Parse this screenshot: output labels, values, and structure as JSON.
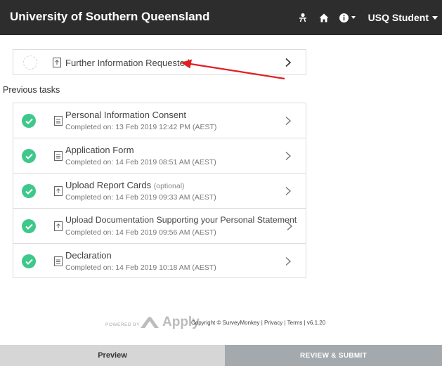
{
  "header": {
    "title": "University of Southern Queensland",
    "user_label": "USQ Student"
  },
  "current_task": {
    "title": "Further Information Requested"
  },
  "previous_label": "Previous tasks",
  "previous_tasks": [
    {
      "title": "Personal Information Consent",
      "optional": "",
      "completed": "Completed on: 13 Feb 2019 12:42 PM (AEST)",
      "icon": "document-icon"
    },
    {
      "title": "Application Form",
      "optional": "",
      "completed": "Completed on: 14 Feb 2019 08:51 AM (AEST)",
      "icon": "document-icon"
    },
    {
      "title": "Upload Report Cards",
      "optional": "(optional)",
      "completed": "Completed on: 14 Feb 2019 09:33 AM (AEST)",
      "icon": "upload-icon"
    },
    {
      "title": "Upload Documentation Supporting your Personal Statement",
      "optional": "",
      "completed": "Completed on: 14 Feb 2019 09:56 AM (AEST)",
      "icon": "upload-icon"
    },
    {
      "title": "Declaration",
      "optional": "",
      "completed": "Completed on: 14 Feb 2019 10:18 AM (AEST)",
      "icon": "document-icon"
    }
  ],
  "footer": {
    "powered_by": "POWERED BY",
    "apply_brand": "Apply",
    "copyright": "Copyright © SurveyMonkey | Privacy | Terms | v6.1.20"
  },
  "bottom_tabs": {
    "preview": "Preview",
    "review": "REVIEW & SUBMIT"
  },
  "colors": {
    "topbar": "#2d2d2d",
    "check": "#3ec88b",
    "arrow": "#e02020",
    "review_tab": "#a4a9ad"
  }
}
